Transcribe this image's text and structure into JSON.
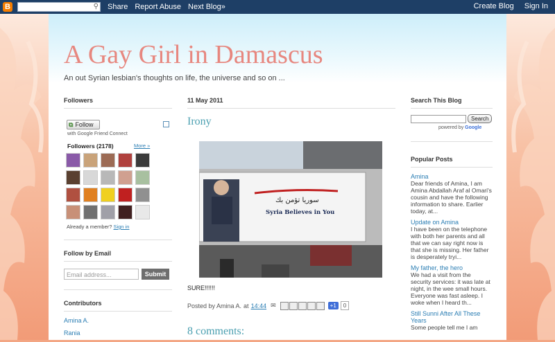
{
  "navbar": {
    "logo": "B",
    "links": [
      "Share",
      "Report Abuse",
      "Next Blog»"
    ],
    "right_links": [
      "Create Blog",
      "Sign In"
    ]
  },
  "header": {
    "title": "A Gay Girl in Damascus",
    "description": "An out Syrian lesbian's thoughts on life, the universe and so on ..."
  },
  "sidebar_left": {
    "followers_title": "Followers",
    "follow_label": "Follow",
    "gfc_text": "with Google Friend Connect",
    "followers_count": "Followers (2178)",
    "more_link": "More »",
    "already_member": "Already a member?",
    "sign_in": "Sign in",
    "follow_by_email_title": "Follow by Email",
    "email_placeholder": "Email address...",
    "submit_label": "Submit",
    "contributors_title": "Contributors",
    "contributors": [
      "Amina A.",
      "Rania"
    ]
  },
  "post": {
    "date": "11 May 2011",
    "title": "Irony",
    "image_caption_arabic": "سوريا تؤمن بك",
    "image_caption": "Syria Believes in You",
    "body": "SURE!!!!!!",
    "posted_by": "Posted by Amina A.",
    "at": "at",
    "time": "14:44",
    "plusone": "+1",
    "plusone_count": "0",
    "comments_title": "8 comments:"
  },
  "sidebar_right": {
    "search_title": "Search This Blog",
    "search_button": "Search",
    "powered_by": "powered by",
    "google": "Google",
    "popular_title": "Popular Posts",
    "popular": [
      {
        "title": "Amina",
        "snippet": "Dear friends of Amina, I am Amina Abdallah Araf al Omari's cousin and have the following information to share. Earlier today, at..."
      },
      {
        "title": "Update on Amina",
        "snippet": "I have been on the telephone with both her parents and all that we can say right now is that she is missing. Her father is desperately tryi..."
      },
      {
        "title": "My father, the hero",
        "snippet": "We had a visit from the security services: it was late at night, in the wee small hours. Everyone was fast asleep. I woke when I heard th..."
      },
      {
        "title": "Still Sunni After All These Years",
        "snippet": "Some people tell me I am"
      }
    ]
  }
}
